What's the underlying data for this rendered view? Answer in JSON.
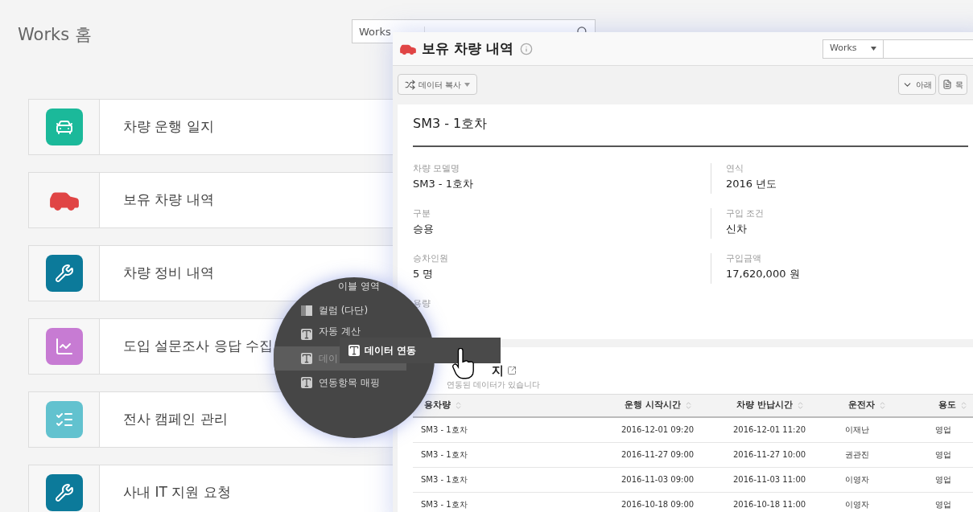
{
  "page": {
    "title": "Works 홈",
    "search": {
      "scope": "Works"
    }
  },
  "apps": [
    {
      "name": "차량 운행 일지",
      "kind": "car-front",
      "color": "#1bb99a"
    },
    {
      "name": "보유 차량 내역",
      "kind": "car"
    },
    {
      "name": "차량 정비 내역",
      "kind": "tools",
      "color": "#0c7a9a"
    },
    {
      "name": "도입 설문조사 응답 수집",
      "kind": "chart",
      "color": "#c77bd3"
    },
    {
      "name": "전사 캠페인 관리",
      "kind": "checklist",
      "color": "#62c2cf"
    },
    {
      "name": "사내 IT 지원 요청",
      "kind": "tools",
      "color": "#0c7a9a"
    }
  ],
  "window": {
    "title": "보유 차량 내역",
    "scope": "Works",
    "toolbar": {
      "copy_button": "데이터 복사",
      "buttons": [
        {
          "label": "아래",
          "kind": "chevron"
        },
        {
          "label": "목",
          "kind": "list"
        }
      ]
    },
    "record": {
      "title": "SM3 - 1호차",
      "fields": [
        {
          "label": "차량 모델명",
          "value": "SM3 - 1호차"
        },
        {
          "label": "연식",
          "value": "2016 년도"
        },
        {
          "label": "구분",
          "value": "승용"
        },
        {
          "label": "구입 조건",
          "value": "신차"
        },
        {
          "label": "승차인원",
          "value": "5 명"
        },
        {
          "label": "구입금액",
          "value": "17,620,000 원"
        },
        {
          "label": "용량"
        }
      ]
    },
    "section": {
      "title": "지",
      "subtitle": "연동된 데이터가 있습니다"
    },
    "table": {
      "columns": [
        "용차량",
        "운행 시작시간",
        "차량 반납시간",
        "운전자",
        "용도"
      ],
      "rows": [
        [
          "SM3 - 1호차",
          "2016-12-01 09:20",
          "2016-12-01 11:20",
          "이재난",
          "영업"
        ],
        [
          "SM3 - 1호차",
          "2016-11-27 09:00",
          "2016-11-27 10:00",
          "권관진",
          "영업"
        ],
        [
          "SM3 - 1호차",
          "2016-11-03 09:00",
          "2016-11-03 11:00",
          "이영자",
          "영업"
        ],
        [
          "SM3 - 1호차",
          "2016-10-18 09:00",
          "2016-10-18 11:00",
          "이영자",
          "영업"
        ]
      ]
    }
  },
  "magnifier": {
    "items": [
      {
        "label": "이블 영역",
        "kind": "none",
        "selected": false
      },
      {
        "label": "컬럼 (다단)",
        "kind": "columns",
        "selected": false
      },
      {
        "label": "자동 계산",
        "kind": "field",
        "selected": false
      },
      {
        "label": "데이",
        "kind": "field",
        "selected": true
      },
      {
        "label": "연동항목 매핑",
        "kind": "field",
        "selected": false
      }
    ],
    "dragged": {
      "label": "데이터 연동"
    }
  }
}
